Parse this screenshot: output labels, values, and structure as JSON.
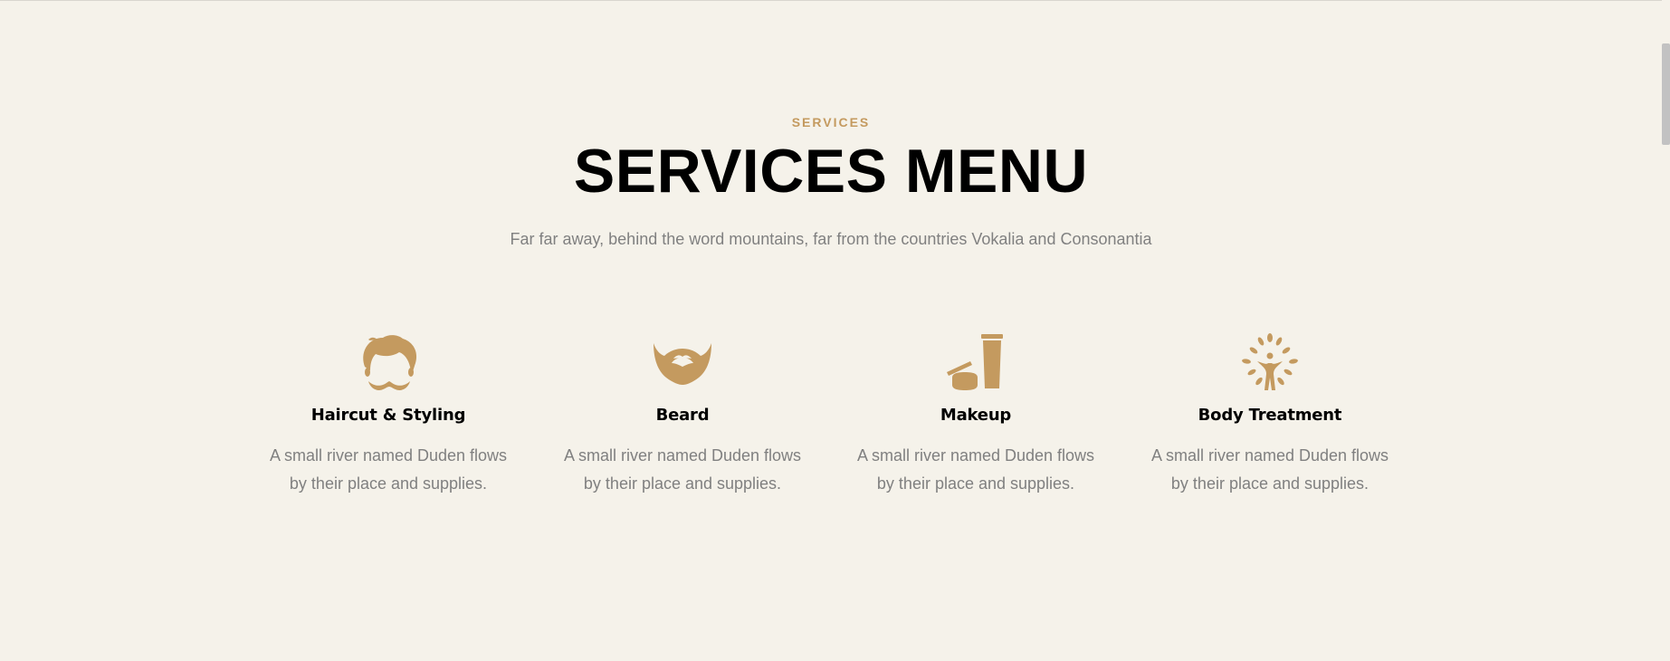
{
  "section": {
    "subheading": "SERVICES",
    "heading": "SERVICES MENU",
    "lead": "Far far away, behind the word mountains, far from the countries Vokalia and Consonantia"
  },
  "services": [
    {
      "icon": "haircut-mustache-icon",
      "title": "Haircut & Styling",
      "line1": "A small river named Duden flows",
      "line2": "by their place and supplies."
    },
    {
      "icon": "beard-icon",
      "title": "Beard",
      "line1": "A small river named Duden flows",
      "line2": "by their place and supplies."
    },
    {
      "icon": "makeup-icon",
      "title": "Makeup",
      "line1": "A small river named Duden flows",
      "line2": "by their place and supplies."
    },
    {
      "icon": "body-treatment-icon",
      "title": "Body Treatment",
      "line1": "A small river named Duden flows",
      "line2": "by their place and supplies."
    }
  ],
  "colors": {
    "background": "#f5f2ea",
    "accent": "#c49a5f",
    "heading": "#000000",
    "muted_text": "#808080"
  }
}
